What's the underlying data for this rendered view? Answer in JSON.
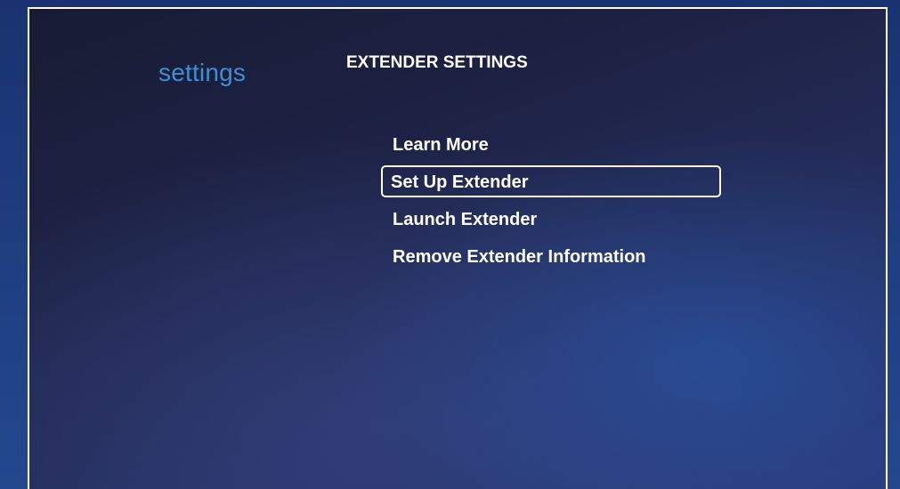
{
  "section": {
    "title": "settings"
  },
  "page": {
    "heading": "EXTENDER SETTINGS"
  },
  "menu": {
    "focused_index": 1,
    "items": [
      {
        "label": "Learn More"
      },
      {
        "label": "Set Up Extender"
      },
      {
        "label": "Launch Extender"
      },
      {
        "label": "Remove Extender Information"
      }
    ]
  },
  "colors": {
    "section_title": "#3f8fd6",
    "text": "#ffffff",
    "focus_border": "#ffffff"
  }
}
